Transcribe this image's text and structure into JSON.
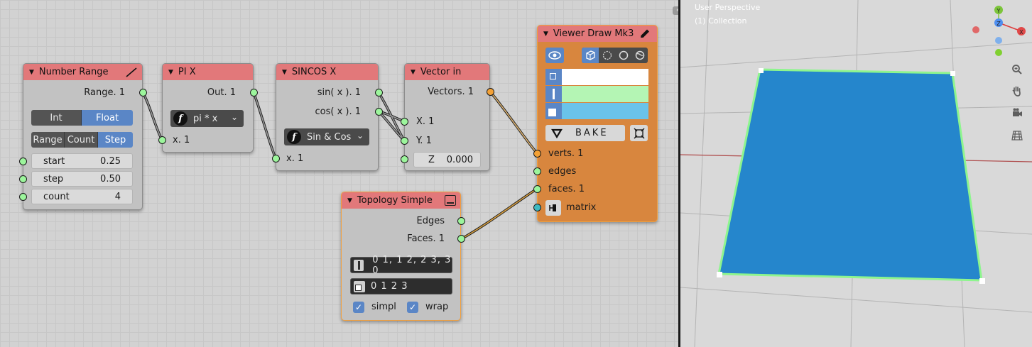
{
  "node_editor": {
    "nodes": {
      "number_range": {
        "title": "Number Range",
        "output": "Range. 1",
        "mode_options": [
          "Int",
          "Float"
        ],
        "mode_selected": "Float",
        "submode_options": [
          "Range",
          "Count",
          "Step"
        ],
        "submode_selected": "Step",
        "params": [
          {
            "label": "start",
            "value": "0.25"
          },
          {
            "label": "step",
            "value": "0.50"
          },
          {
            "label": "count",
            "value": "4"
          }
        ]
      },
      "pi_x": {
        "title": "PI X",
        "output": "Out. 1",
        "function": "pi * x",
        "input": "x. 1"
      },
      "sincos_x": {
        "title": "SINCOS X",
        "outputs": [
          "sin( x ). 1",
          "cos( x ). 1"
        ],
        "function": "Sin & Cos",
        "input": "x. 1"
      },
      "vector_in": {
        "title": "Vector in",
        "output": "Vectors. 1",
        "inputs": [
          "X. 1",
          "Y. 1"
        ],
        "z_label": "Z",
        "z_value": "0.000"
      },
      "viewer_draw": {
        "title": "Viewer Draw Mk3",
        "colors": {
          "vertex": "#ffffff",
          "edge": "#b4f5b4",
          "face": "#6ac3ea"
        },
        "bake_label": "BAKE",
        "inputs": [
          "verts. 1",
          "edges",
          "faces. 1",
          "matrix"
        ]
      },
      "topology_simple": {
        "title": "Topology Simple",
        "outputs": [
          "Edges",
          "Faces. 1"
        ],
        "edges_text": "0 1, 1 2, 2 3, 3 0",
        "faces_text": "0 1 2 3",
        "checkbox_simpl": "simpl",
        "checkbox_wrap": "wrap",
        "simpl_checked": true,
        "wrap_checked": true
      }
    }
  },
  "viewport": {
    "view_name": "User Perspective",
    "collection": "(1) Collection",
    "gizmo_labels": [
      "Y",
      "Z",
      "X"
    ],
    "nav_icons": [
      "zoom-icon",
      "hand-pan-icon",
      "camera-icon",
      "grid-icon"
    ],
    "plane_color": "#2586cc",
    "edge_color": "#8ef58e"
  }
}
